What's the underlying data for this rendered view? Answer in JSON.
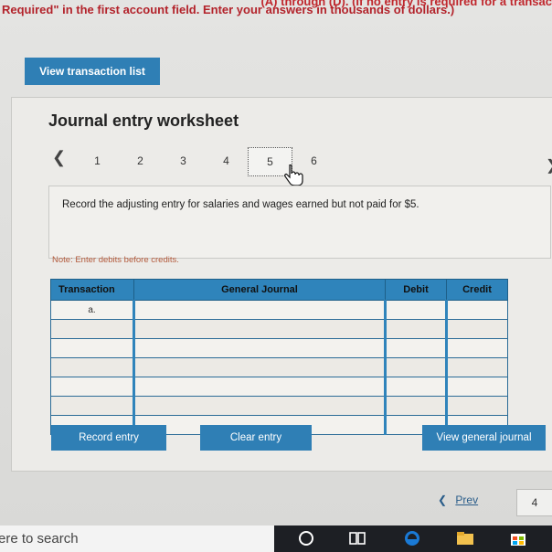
{
  "instructions": {
    "line1": "(A) through (D). (If no entry is required for a transac",
    "line2": "Required\" in the first account field. Enter your answers in thousands of dollars.)"
  },
  "view_transaction_list": "View transaction list",
  "worksheet": {
    "title": "Journal entry worksheet",
    "tabs": [
      "1",
      "2",
      "3",
      "4",
      "5",
      "6"
    ],
    "active_tab": "5",
    "prompt": "Record the adjusting entry for salaries and wages earned but not paid for $5.",
    "note": "Note: Enter debits before credits."
  },
  "journal_table": {
    "headers": [
      "Transaction",
      "General Journal",
      "Debit",
      "Credit"
    ],
    "first_transaction": "a."
  },
  "buttons": {
    "record": "Record entry",
    "clear": "Clear entry",
    "view_general": "View general journal"
  },
  "footer": {
    "prev": "Prev",
    "page": "4"
  },
  "taskbar": {
    "search_placeholder": "ere to search"
  },
  "colors": {
    "accent": "#2f7fb5",
    "instructions": "#b3232b"
  }
}
